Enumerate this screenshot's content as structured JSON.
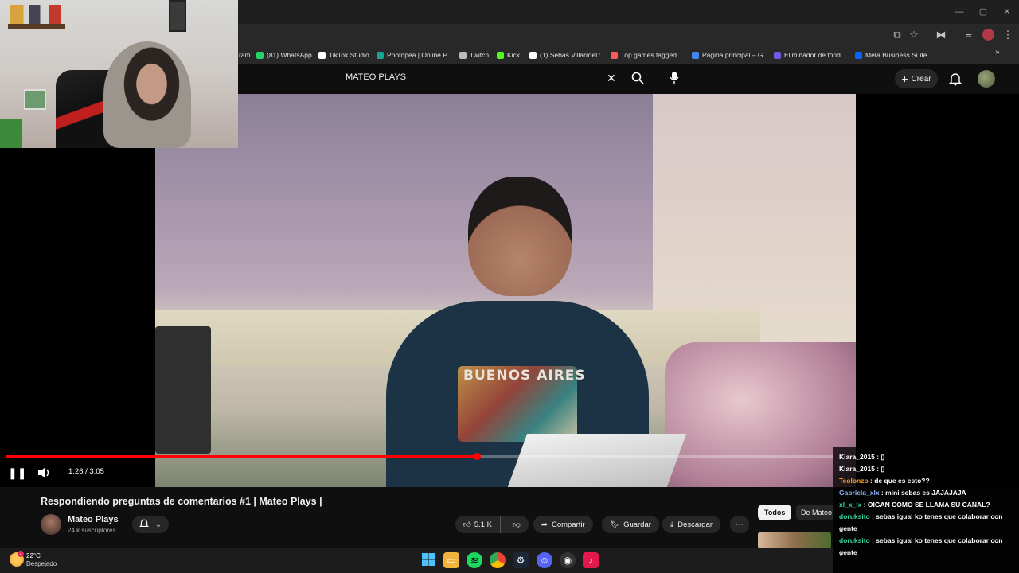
{
  "window": {
    "minimize": "—",
    "maximize": "▢",
    "close": "✕"
  },
  "toolbar": {
    "cast": "⧉",
    "star": "☆",
    "extensions": "⧓",
    "profile": "⋮"
  },
  "bookmarks": [
    {
      "label": "ram",
      "color": "#c13584"
    },
    {
      "label": "(81) WhatsApp",
      "color": "#25d366"
    },
    {
      "label": "TikTok Studio",
      "color": "#ffffff"
    },
    {
      "label": "Photopea | Online P...",
      "color": "#18a497"
    },
    {
      "label": "Twitch",
      "color": "#bbbbbb"
    },
    {
      "label": "Kick",
      "color": "#53fc18"
    },
    {
      "label": "(1) Sebas Villarroel :...",
      "color": "#ffffff"
    },
    {
      "label": "Top games tagged...",
      "color": "#fa5c5c"
    },
    {
      "label": "Página principal – G...",
      "color": "#4285f4"
    },
    {
      "label": "Eliminador de fond...",
      "color": "#6c5ce7"
    },
    {
      "label": "Meta Business Suite",
      "color": "#0866ff"
    }
  ],
  "youtube": {
    "search_value": "MATEO PLAYS",
    "create_label": "Crear"
  },
  "player": {
    "time": "1:26 / 3:05",
    "progress_fraction": 0.568,
    "shirt_text": "BUENOS  AIRES"
  },
  "video": {
    "title": "Respondiendo preguntas de comentarios #1 | Mateo Plays |",
    "channel": "Mateo Plays",
    "subscribers": "24 k suscriptores",
    "likes": "5.1 K",
    "share": "Compartir",
    "save": "Guardar",
    "download": "Descargar"
  },
  "chips": {
    "all": "Todos",
    "mateo": "De Mateo"
  },
  "chat": [
    {
      "user": "Kiara_2015",
      "color": "#ffffff",
      "msg": " : ▯"
    },
    {
      "user": "Kiara_2015",
      "color": "#ffffff",
      "msg": " : ▯"
    },
    {
      "user": "Teolonzo",
      "color": "#ff9f1c",
      "msg": " : de que es esto??"
    },
    {
      "user": "Gabriela_xlx",
      "color": "#8ab4f8",
      "msg": " : mini sebas es JAJAJAJA"
    },
    {
      "user": "xl_x_lx",
      "color": "#34d399",
      "msg": " : OIGAN COMO SE LLAMA SU CANAL?"
    },
    {
      "user": "doruksito",
      "color": "#34d399",
      "msg": " : sebas igual ko tenes que colaborar con gente"
    },
    {
      "user": "doruksito",
      "color": "#34d399",
      "msg": " : sebas igual ko tenes que colaborar con gente"
    }
  ],
  "taskbar": {
    "temperature": "22°C",
    "condition": "Despejado",
    "badge": "1"
  }
}
